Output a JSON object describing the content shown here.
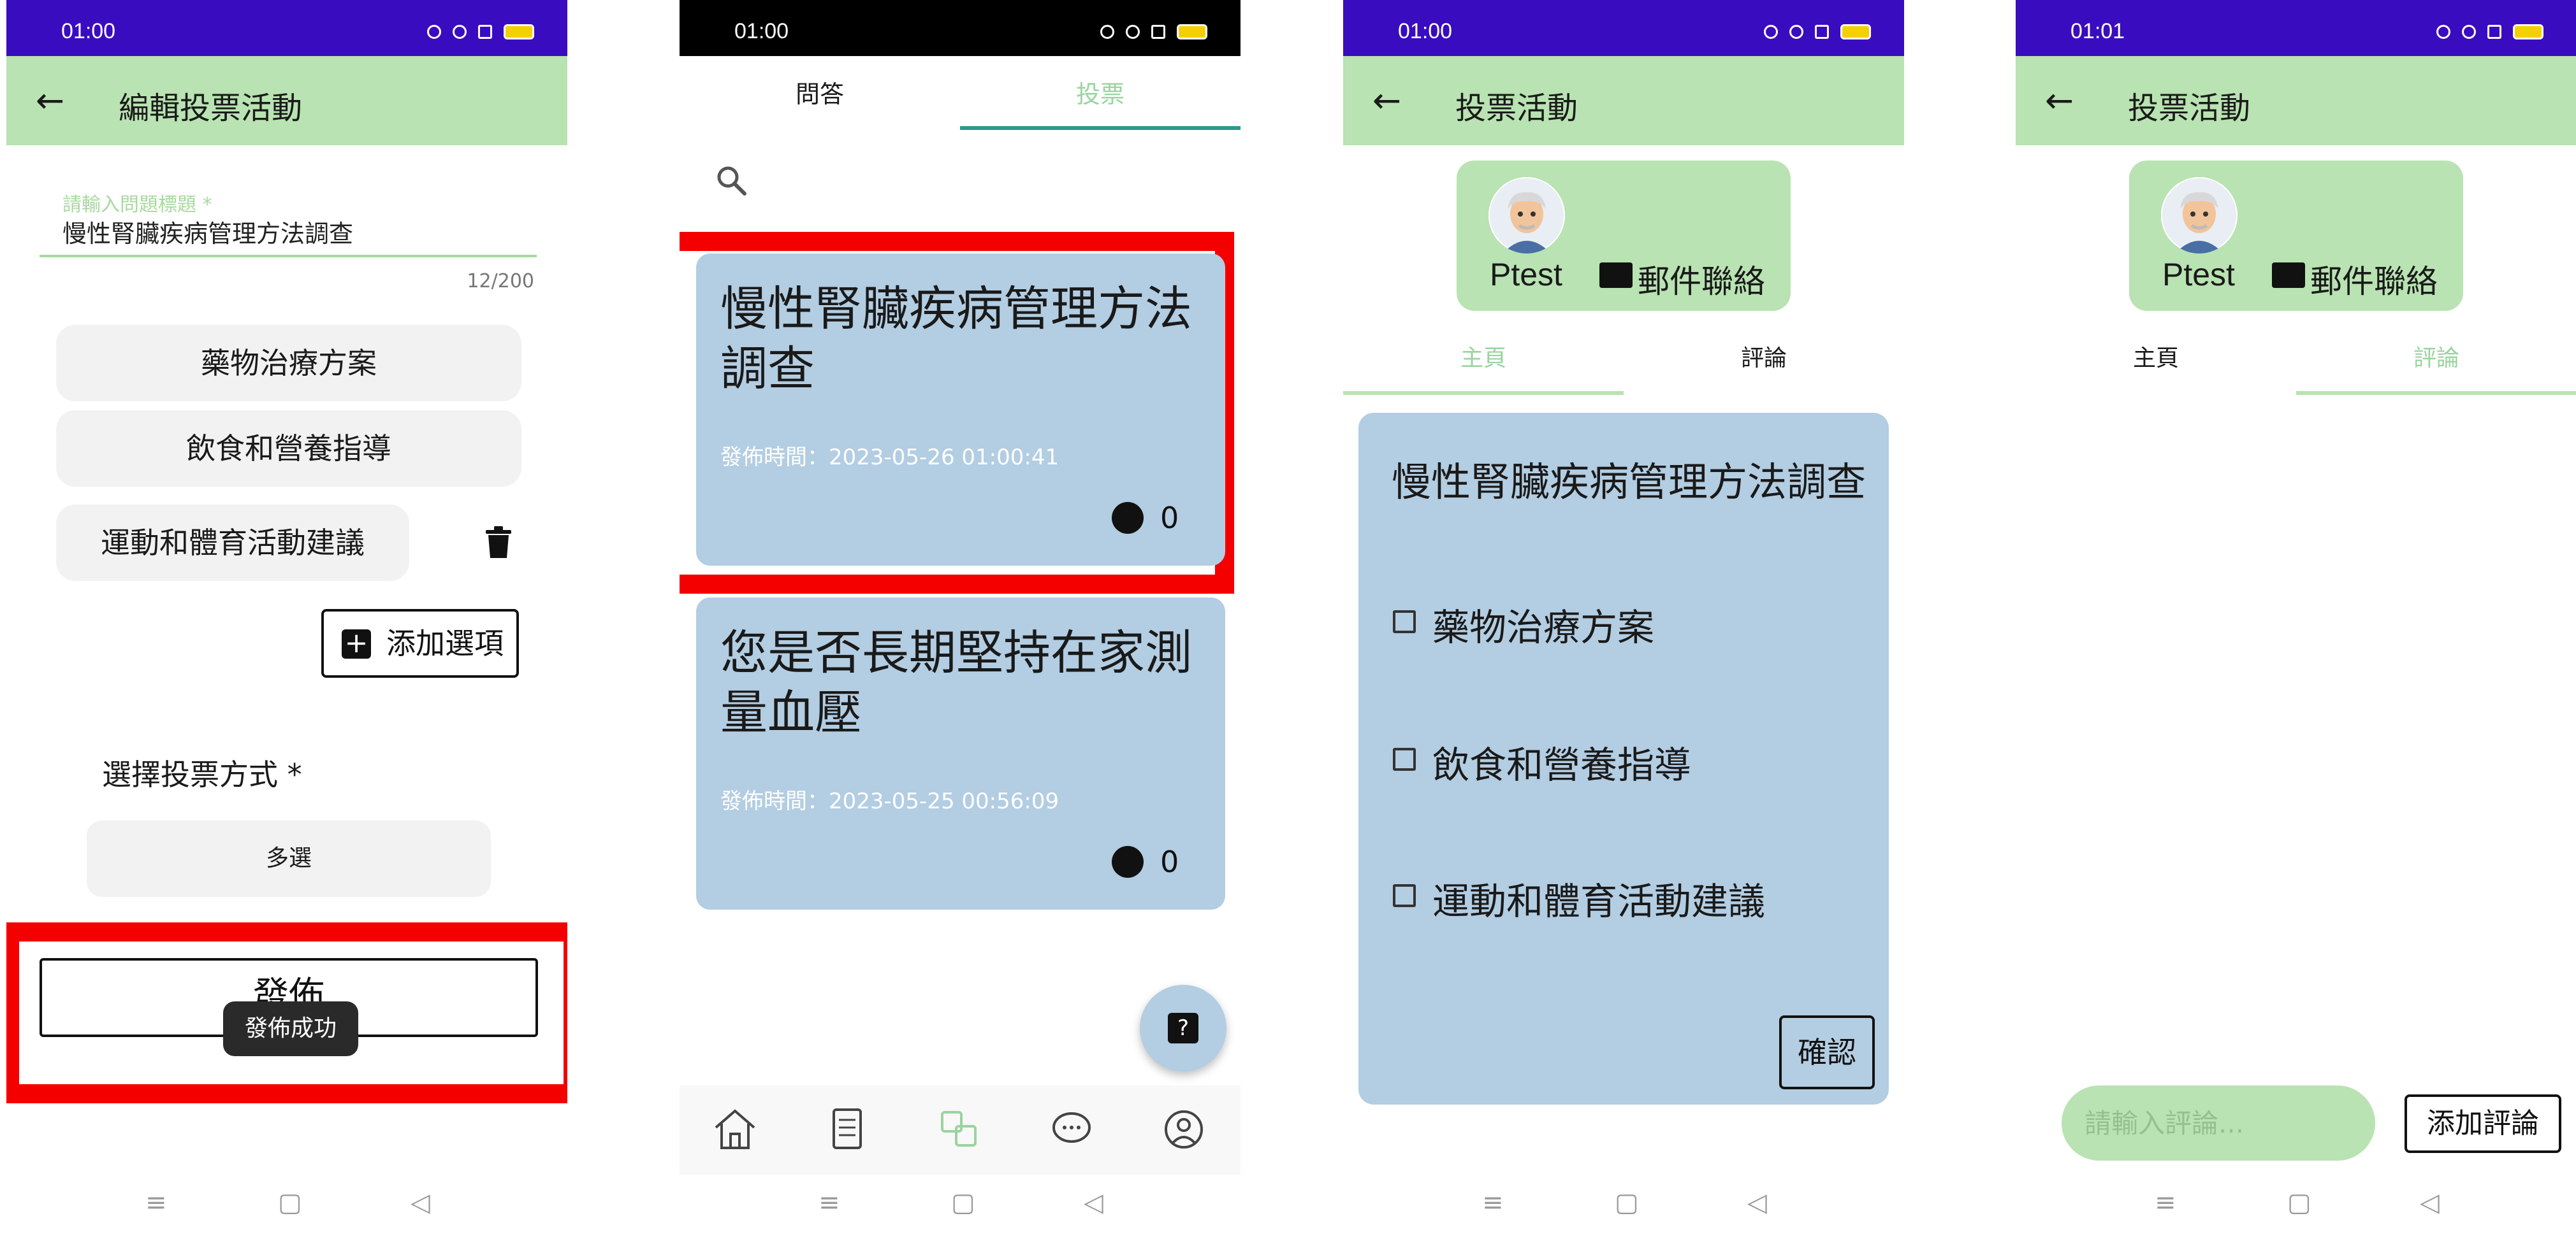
{
  "status": {
    "p1_time": "01:00",
    "p2_time": "01:00",
    "p3_time": "01:00",
    "p4_time": "01:01"
  },
  "edit_poll": {
    "title": "編輯投票活動",
    "field_label": "請輸入問題標題 *",
    "field_value": "慢性腎臟疾病管理方法調查",
    "char_counter": "12/200",
    "options": [
      "藥物治療方案",
      "飲食和營養指導",
      "運動和體育活動建議"
    ],
    "add_option_label": "添加選項",
    "vote_mode_label": "選擇投票方式 *",
    "vote_mode_value": "多選",
    "publish_label": "發佈",
    "toast": "發佈成功"
  },
  "poll_list": {
    "tabs": [
      "問答",
      "投票"
    ],
    "cards": [
      {
        "title": "慢性腎臟疾病管理方法調查",
        "time": "發佈時間：2023-05-26 01:00:41",
        "likes": "0"
      },
      {
        "title": "您是否長期堅持在家測量血壓",
        "time": "發佈時間：2023-05-25 00:56:09",
        "likes": "0"
      }
    ]
  },
  "poll_detail": {
    "title": "投票活動",
    "profile_name": "Ptest",
    "mail_label": "郵件聯絡",
    "tabs": [
      "主頁",
      "評論"
    ],
    "poll_title": "慢性腎臟疾病管理方法調查",
    "options": [
      "藥物治療方案",
      "飲食和營養指導",
      "運動和體育活動建議"
    ],
    "confirm_label": "確認"
  },
  "comments": {
    "title": "投票活動",
    "profile_name": "Ptest",
    "mail_label": "郵件聯絡",
    "tabs": [
      "主頁",
      "評論"
    ],
    "input_placeholder": "請輸入評論...",
    "add_comment_label": "添加評論"
  },
  "colors": {
    "status_purple": "#3a0cbf",
    "appbar_green": "#b9e3b2",
    "card_blue": "#b3cde2",
    "tab_teal": "#2b9a8a",
    "highlight_red": "#f40000"
  }
}
